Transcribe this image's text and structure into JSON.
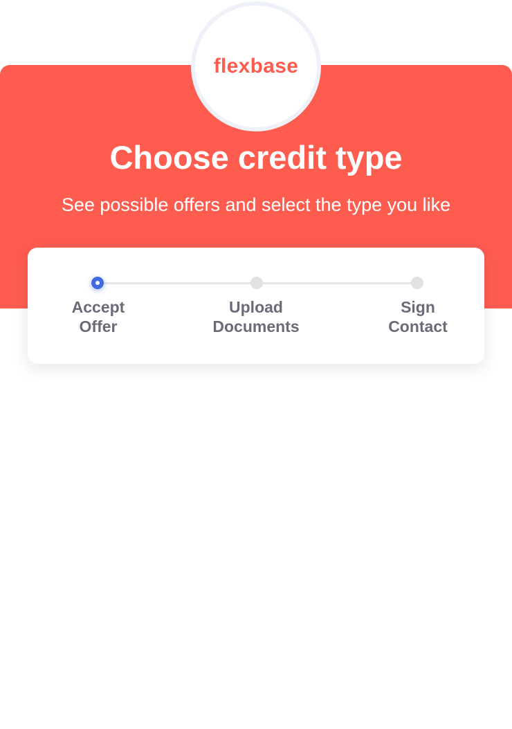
{
  "brand": {
    "logo_text": "flexbase",
    "accent_color": "#ff5c50"
  },
  "header": {
    "title": "Choose credit type",
    "subtitle": "See possible offers and select the type you like"
  },
  "progress": {
    "active_color": "#4169e1",
    "current_step": 1,
    "steps": [
      {
        "label": "Accept\nOffer",
        "state": "active"
      },
      {
        "label": "Upload\nDocuments",
        "state": "inactive"
      },
      {
        "label": "Sign\nContact",
        "state": "inactive"
      }
    ]
  }
}
